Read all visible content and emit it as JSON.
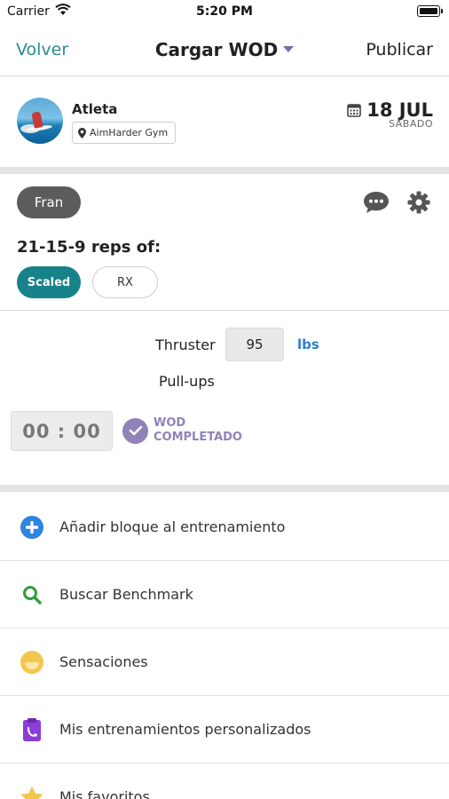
{
  "status_bar": {
    "carrier": "Carrier",
    "time": "5:20 PM"
  },
  "nav": {
    "back_label": "Volver",
    "title": "Cargar WOD",
    "publish_label": "Publicar"
  },
  "athlete": {
    "name": "Atleta",
    "gym": "AimHarder Gym",
    "date_day": "18 JUL",
    "weekday": "SÁBADO"
  },
  "wod": {
    "name": "Fran",
    "reps_scheme": "21-15-9 reps of:",
    "levels": [
      {
        "label": "Scaled",
        "selected": true
      },
      {
        "label": "RX",
        "selected": false
      }
    ],
    "movements": [
      {
        "name": "Thruster",
        "weight": "95",
        "unit": "lbs"
      },
      {
        "name": "Pull-ups"
      }
    ],
    "time_value": "00 : 00",
    "completed_label_line1": "WOD",
    "completed_label_line2": "COMPLETADO",
    "icons": {
      "comment": "chat-bubble-icon",
      "settings": "gear-icon"
    }
  },
  "menu": [
    {
      "label": "Añadir bloque al entrenamiento",
      "icon": "plus-circle-icon",
      "color": "#2f84e0"
    },
    {
      "label": "Buscar Benchmark",
      "icon": "search-icon",
      "color": "#2e9e3c"
    },
    {
      "label": "Sensaciones",
      "icon": "face-icon",
      "color": "#f3c64d"
    },
    {
      "label": "Mis entrenamientos personalizados",
      "icon": "clipboard-icon",
      "color": "#8b3dd6"
    },
    {
      "label": "Mis favoritos",
      "icon": "star-icon",
      "color": "#f3c64d"
    }
  ],
  "colors": {
    "accent_teal": "#2b8a8f",
    "scaled_bg": "#17828a",
    "purple": "#8f83b8",
    "link_blue": "#2f7fd4"
  }
}
